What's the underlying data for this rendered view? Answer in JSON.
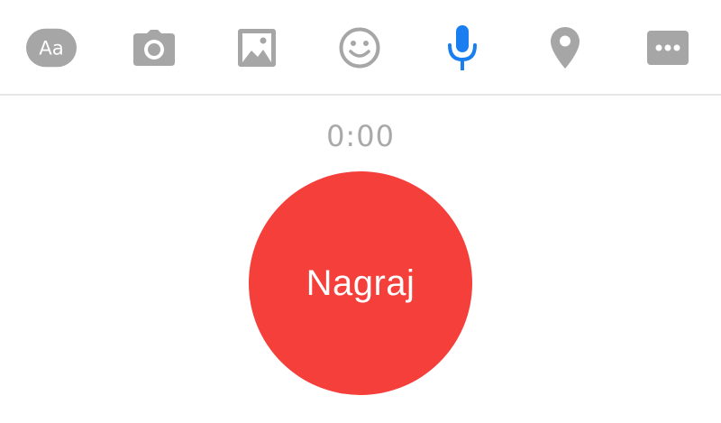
{
  "colors": {
    "icon_inactive": "#a6a6a6",
    "icon_active": "#1a7ef0",
    "record_button": "#f43f3a",
    "timer_text": "#a9a9a9"
  },
  "toolbar": {
    "items": [
      {
        "icon": "text-icon",
        "label": "Aa",
        "active": false
      },
      {
        "icon": "camera-icon",
        "active": false
      },
      {
        "icon": "gallery-icon",
        "active": false
      },
      {
        "icon": "emoji-icon",
        "active": false
      },
      {
        "icon": "microphone-icon",
        "active": true
      },
      {
        "icon": "location-icon",
        "active": false
      },
      {
        "icon": "more-icon",
        "active": false
      }
    ]
  },
  "recorder": {
    "timer": "0:00",
    "record_label": "Nagraj"
  }
}
